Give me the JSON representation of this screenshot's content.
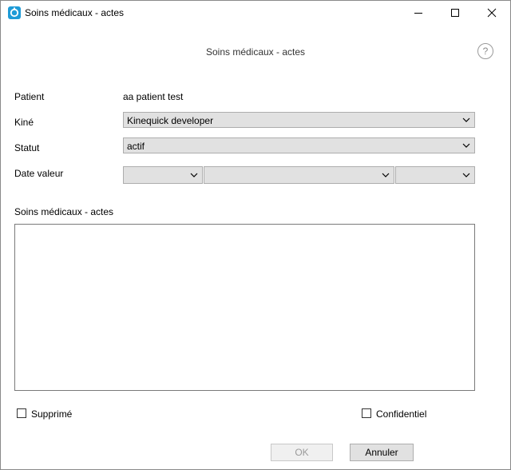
{
  "window": {
    "title": "Soins médicaux - actes",
    "controls": [
      "minimize-icon",
      "maximize-icon",
      "close-icon"
    ]
  },
  "header": {
    "title": "Soins médicaux - actes",
    "help_label": "?"
  },
  "form": {
    "patient_label": "Patient",
    "patient_value": "aa patient test",
    "kine_label": "Kiné",
    "kine_value": "Kinequick developer",
    "statut_label": "Statut",
    "statut_value": "actif",
    "date_label": "Date valeur",
    "date_day_value": "",
    "date_month_value": "",
    "date_year_value": "",
    "notes_label": "Soins médicaux - actes",
    "notes_value": ""
  },
  "options": {
    "supprime_label": "Supprimé",
    "supprime_checked": false,
    "confidentiel_label": "Confidentiel",
    "confidentiel_checked": false
  },
  "buttons": {
    "ok_label": "OK",
    "cancel_label": "Annuler"
  },
  "colors": {
    "app_icon": "#1e9bd7",
    "combo_bg": "#e1e1e1",
    "disabled_text": "#9a9a9a"
  }
}
